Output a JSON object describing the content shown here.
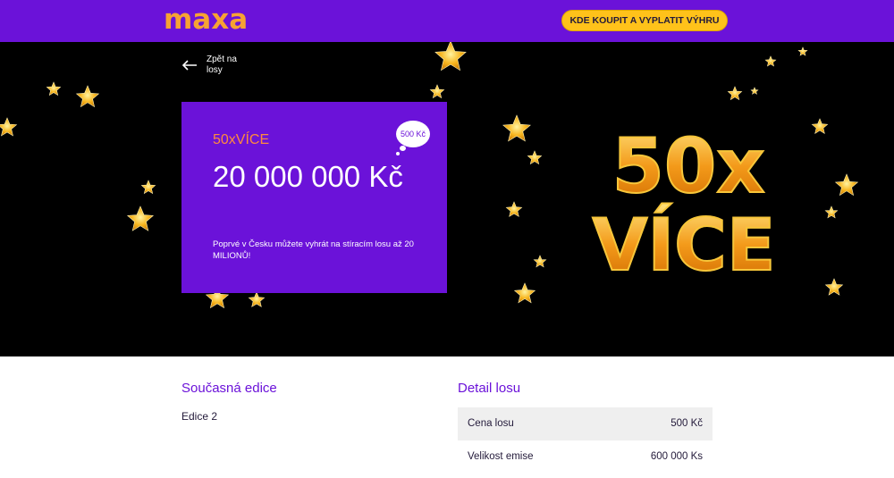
{
  "header": {
    "logo": "maxa",
    "cta_label": "KDE KOUPIT A VYPLATIT VÝHRU"
  },
  "hero": {
    "back_label": "Zpět na losy",
    "card": {
      "subtitle": "50xVÍCE",
      "amount": "20 000 000 Kč",
      "description": "Poprvé v Česku můžete vyhrát na stíracím losu až 20 MILIONŮ!",
      "price_badge": "500 Kč"
    },
    "art": {
      "line1": "50x",
      "line2": "VÍCE"
    }
  },
  "current_edition": {
    "title": "Současná edice",
    "value": "Edice 2"
  },
  "ticket_detail": {
    "title": "Detail losu",
    "rows": [
      {
        "label": "Cena losu",
        "value": "500 Kč"
      },
      {
        "label": "Velikost emise",
        "value": "600 000 Ks"
      }
    ]
  },
  "colors": {
    "brand_purple": "#6b12d9",
    "logo_orange": "#f7a233",
    "cta_yellow": "#ffc21a",
    "subtitle_orange": "#ff8a3d",
    "gold": "#f2a31c"
  }
}
